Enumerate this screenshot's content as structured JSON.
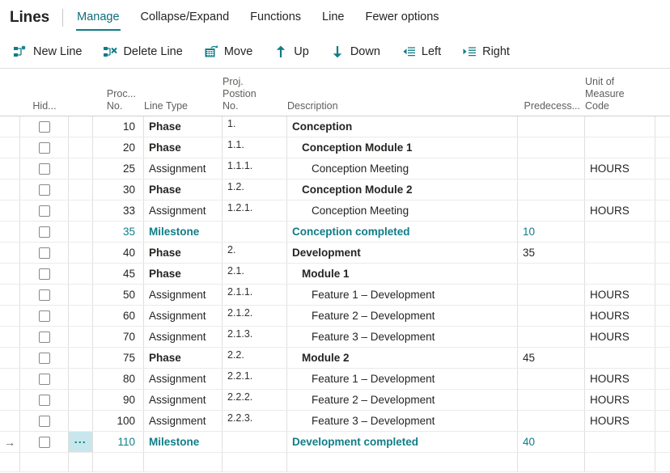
{
  "header": {
    "title": "Lines",
    "tabs": [
      {
        "label": "Manage",
        "active": true
      },
      {
        "label": "Collapse/Expand",
        "active": false
      },
      {
        "label": "Functions",
        "active": false
      },
      {
        "label": "Line",
        "active": false
      },
      {
        "label": "Fewer options",
        "active": false
      }
    ],
    "commands": [
      {
        "label": "New Line",
        "icon": "new-line-icon"
      },
      {
        "label": "Delete Line",
        "icon": "delete-line-icon"
      },
      {
        "label": "Move",
        "icon": "move-icon"
      },
      {
        "label": "Up",
        "icon": "arrow-up-icon"
      },
      {
        "label": "Down",
        "icon": "arrow-down-icon"
      },
      {
        "label": "Left",
        "icon": "indent-left-icon"
      },
      {
        "label": "Right",
        "icon": "indent-right-icon"
      }
    ]
  },
  "accent_color": "#0F7D87",
  "selection_color": "#c7e7ec",
  "grid": {
    "columns": [
      {
        "key": "indicator",
        "label": ""
      },
      {
        "key": "hidden",
        "label": "Hid..."
      },
      {
        "key": "menu",
        "label": ""
      },
      {
        "key": "proc_no",
        "label": "Proc...\nNo."
      },
      {
        "key": "line_type",
        "label": "Line Type"
      },
      {
        "key": "proj_position_no",
        "label": "Proj.\nPostion\nNo."
      },
      {
        "key": "description",
        "label": "Description"
      },
      {
        "key": "predecessor",
        "label": "Predecess..."
      },
      {
        "key": "unit_of_measure_code",
        "label": "Unit of\nMeasure\nCode"
      }
    ],
    "column_labels": {
      "hidden": "Hid...",
      "proc_no_l1": "Proc...",
      "proc_no_l2": "No.",
      "line_type": "Line Type",
      "pos_l1": "Proj.",
      "pos_l2": "Postion",
      "pos_l3": "No.",
      "description": "Description",
      "predecessor": "Predecess...",
      "uom_l1": "Unit of",
      "uom_l2": "Measure",
      "uom_l3": "Code"
    },
    "rows": [
      {
        "selected": false,
        "checked": false,
        "proc_no": "10",
        "line_type": "Phase",
        "pos": "1.",
        "desc": "Conception",
        "indent": 0,
        "pred": "",
        "uom": "",
        "style": "bold"
      },
      {
        "selected": false,
        "checked": false,
        "proc_no": "20",
        "line_type": "Phase",
        "pos": "1.1.",
        "desc": "Conception Module 1",
        "indent": 1,
        "pred": "",
        "uom": "",
        "style": "bold"
      },
      {
        "selected": false,
        "checked": false,
        "proc_no": "25",
        "line_type": "Assignment",
        "pos": "1.1.1.",
        "desc": "Conception Meeting",
        "indent": 2,
        "pred": "",
        "uom": "HOURS",
        "style": "normal"
      },
      {
        "selected": false,
        "checked": false,
        "proc_no": "30",
        "line_type": "Phase",
        "pos": "1.2.",
        "desc": "Conception Module 2",
        "indent": 1,
        "pred": "",
        "uom": "",
        "style": "bold"
      },
      {
        "selected": false,
        "checked": false,
        "proc_no": "33",
        "line_type": "Assignment",
        "pos": "1.2.1.",
        "desc": "Conception Meeting",
        "indent": 2,
        "pred": "",
        "uom": "HOURS",
        "style": "normal"
      },
      {
        "selected": false,
        "checked": false,
        "proc_no": "35",
        "line_type": "Milestone",
        "pos": "",
        "desc": "Conception completed",
        "indent": 0,
        "pred": "10",
        "uom": "",
        "style": "milestone"
      },
      {
        "selected": false,
        "checked": false,
        "proc_no": "40",
        "line_type": "Phase",
        "pos": "2.",
        "desc": "Development",
        "indent": 0,
        "pred": "35",
        "uom": "",
        "style": "bold"
      },
      {
        "selected": false,
        "checked": false,
        "proc_no": "45",
        "line_type": "Phase",
        "pos": "2.1.",
        "desc": "Module 1",
        "indent": 1,
        "pred": "",
        "uom": "",
        "style": "bold"
      },
      {
        "selected": false,
        "checked": false,
        "proc_no": "50",
        "line_type": "Assignment",
        "pos": "2.1.1.",
        "desc": "Feature 1 – Development",
        "indent": 2,
        "pred": "",
        "uom": "HOURS",
        "style": "normal"
      },
      {
        "selected": false,
        "checked": false,
        "proc_no": "60",
        "line_type": "Assignment",
        "pos": "2.1.2.",
        "desc": "Feature 2 – Development",
        "indent": 2,
        "pred": "",
        "uom": "HOURS",
        "style": "normal"
      },
      {
        "selected": false,
        "checked": false,
        "proc_no": "70",
        "line_type": "Assignment",
        "pos": "2.1.3.",
        "desc": "Feature 3 – Development",
        "indent": 2,
        "pred": "",
        "uom": "HOURS",
        "style": "normal"
      },
      {
        "selected": false,
        "checked": false,
        "proc_no": "75",
        "line_type": "Phase",
        "pos": "2.2.",
        "desc": "Module 2",
        "indent": 1,
        "pred": "45",
        "uom": "",
        "style": "bold"
      },
      {
        "selected": false,
        "checked": false,
        "proc_no": "80",
        "line_type": "Assignment",
        "pos": "2.2.1.",
        "desc": "Feature 1 – Development",
        "indent": 2,
        "pred": "",
        "uom": "HOURS",
        "style": "normal"
      },
      {
        "selected": false,
        "checked": false,
        "proc_no": "90",
        "line_type": "Assignment",
        "pos": "2.2.2.",
        "desc": "Feature 2 – Development",
        "indent": 2,
        "pred": "",
        "uom": "HOURS",
        "style": "normal"
      },
      {
        "selected": false,
        "checked": false,
        "proc_no": "100",
        "line_type": "Assignment",
        "pos": "2.2.3.",
        "desc": "Feature 3 – Development",
        "indent": 2,
        "pred": "",
        "uom": "HOURS",
        "style": "normal"
      },
      {
        "selected": true,
        "checked": false,
        "proc_no": "110",
        "line_type": "Milestone",
        "pos": "",
        "desc": "Development completed",
        "indent": 0,
        "pred": "40",
        "uom": "",
        "style": "milestone"
      }
    ]
  }
}
